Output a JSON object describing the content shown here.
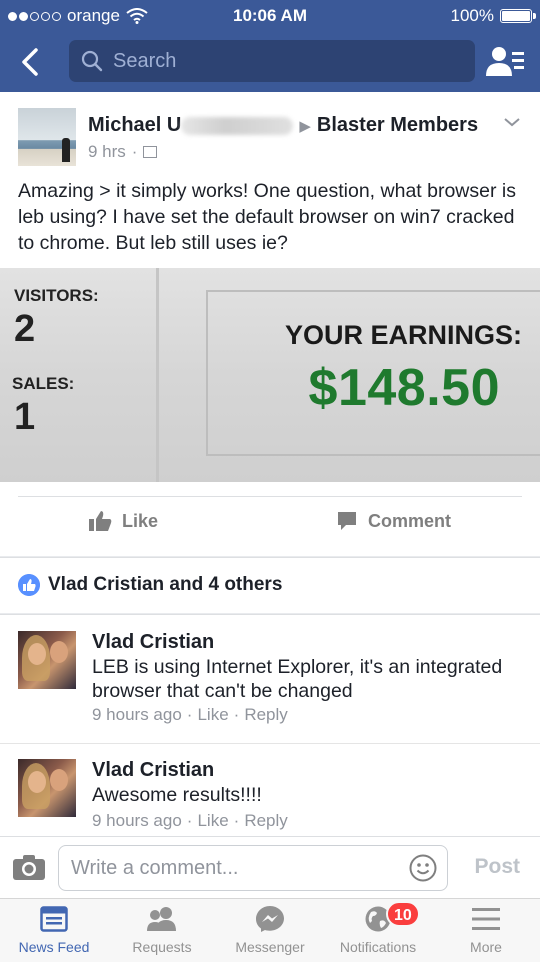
{
  "status_bar": {
    "carrier": "orange",
    "time": "10:06 AM",
    "battery": "100%",
    "signal_bars_filled": 2,
    "signal_bars_total": 5
  },
  "nav": {
    "search_placeholder": "Search"
  },
  "post": {
    "author_visible": "Michael U",
    "group": "Blaster Members",
    "time": "9 hrs",
    "meta_sep": "·",
    "text": "Amazing > it simply works! One question, what browser is leb using? I have set the default browser on win7 cracked to chrome. But leb still uses ie?",
    "photo": {
      "visitors_label": "VISITORS:",
      "visitors_value": "2",
      "sales_label": "SALES:",
      "sales_value": "1",
      "earnings_label": "YOUR EARNINGS:",
      "earnings_value": "$148.50"
    },
    "actions": {
      "like": "Like",
      "comment": "Comment"
    }
  },
  "likes": {
    "summary": "Vlad Cristian and 4 others"
  },
  "comments": [
    {
      "name": "Vlad Cristian",
      "text": "LEB is using Internet Explorer, it's an integrated browser that can't be changed",
      "time": "9 hours ago",
      "like": "Like",
      "reply": "Reply",
      "sep": "·"
    },
    {
      "name": "Vlad Cristian",
      "text": "Awesome results!!!!",
      "time": "9 hours ago",
      "like": "Like",
      "reply": "Reply",
      "sep": "·"
    }
  ],
  "composer": {
    "placeholder": "Write a comment...",
    "post_label": "Post"
  },
  "tabbar": {
    "items": [
      {
        "label": "News Feed",
        "icon": "news-feed-icon"
      },
      {
        "label": "Requests",
        "icon": "requests-icon"
      },
      {
        "label": "Messenger",
        "icon": "messenger-icon"
      },
      {
        "label": "Notifications",
        "icon": "globe-icon"
      },
      {
        "label": "More",
        "icon": "menu-icon"
      }
    ],
    "notifications_badge": "10"
  },
  "colors": {
    "brand": "#3b5998",
    "earnings_green": "#1f7a2e",
    "badge_red": "#fa3e3e",
    "active_tab": "#4267b2"
  }
}
